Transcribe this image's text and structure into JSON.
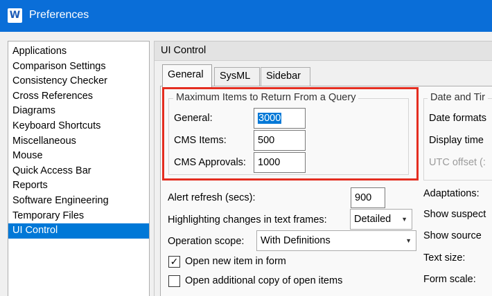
{
  "window": {
    "title": "Preferences",
    "app_icon_letter": "W"
  },
  "nav": {
    "items": [
      "Applications",
      "Comparison Settings",
      "Consistency Checker",
      "Cross References",
      "Diagrams",
      "Keyboard Shortcuts",
      "Miscellaneous",
      "Mouse",
      "Quick Access Bar",
      "Reports",
      "Software Engineering",
      "Temporary Files",
      "UI Control"
    ],
    "selected": "UI Control"
  },
  "panel": {
    "title": "UI Control",
    "tabs": [
      "General",
      "SysML",
      "Sidebar"
    ],
    "active_tab": "General"
  },
  "max_items": {
    "legend": "Maximum Items to Return From a Query",
    "general_label": "General:",
    "general_value": "3000",
    "cms_items_label": "CMS Items:",
    "cms_items_value": "500",
    "cms_approvals_label": "CMS Approvals:",
    "cms_approvals_value": "1000"
  },
  "date_time": {
    "legend": "Date and Tir",
    "date_format_label": "Date formats",
    "display_time_label": "Display time",
    "utc_offset_label": "UTC offset (:"
  },
  "settings": {
    "alert_refresh_label": "Alert refresh (secs):",
    "alert_refresh_value": "900",
    "highlighting_label": "Highlighting changes in text frames:",
    "highlighting_value": "Detailed",
    "operation_scope_label": "Operation scope:",
    "operation_scope_value": "With Definitions",
    "open_new_item_label": "Open new item in form",
    "open_new_item_checked": true,
    "open_additional_label": "Open additional copy of open items",
    "open_additional_checked": false
  },
  "right_column": {
    "adaptations_label": "Adaptations:",
    "show_suspect_label": "Show suspect",
    "show_source_label": "Show source",
    "text_size_label": "Text size:",
    "form_scale_label": "Form scale:"
  },
  "colors": {
    "titlebar": "#0a6ed8",
    "selection": "#0078d7",
    "highlight_border": "#e42d20"
  }
}
